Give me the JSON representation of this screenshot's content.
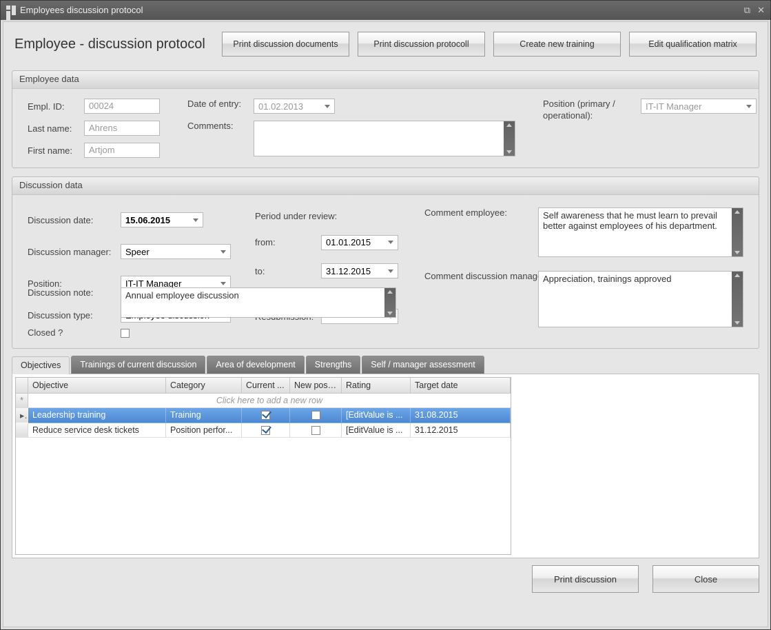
{
  "window_title": "Employees discussion protocol",
  "page_title": "Employee - discussion protocol",
  "toolbar": {
    "print_docs": "Print discussion documents",
    "print_protocol": "Print discussion protocoll",
    "create_training": "Create new training",
    "edit_matrix": "Edit qualification matrix"
  },
  "employee": {
    "group_title": "Employee data",
    "labels": {
      "empl_id": "Empl. ID:",
      "last_name": "Last name:",
      "first_name": "First name:",
      "date_of_entry": "Date of entry:",
      "comments": "Comments:",
      "position": "Position (primary / operational):"
    },
    "values": {
      "empl_id": "00024",
      "last_name": "Ahrens",
      "first_name": "Artjom",
      "date_of_entry": "01.02.2013",
      "comments": "",
      "position": "IT-IT Manager"
    }
  },
  "discussion": {
    "group_title": "Discussion data",
    "labels": {
      "date": "Discussion date:",
      "manager": "Discussion manager:",
      "position": "Position:",
      "type": "Discussion type:",
      "note": "Discussion note:",
      "closed": "Closed ?",
      "period": "Period under review:",
      "from": "from:",
      "to": "to:",
      "resubmission": "Resubmission:",
      "comment_employee": "Comment employee:",
      "comment_manager": "Comment discussion manager"
    },
    "values": {
      "date": "15.06.2015",
      "manager": "Speer",
      "position": "IT-IT Manager",
      "type": "Employee discussion",
      "note": "Annual employee discussion",
      "closed": false,
      "from": "01.01.2015",
      "to": "31.12.2015",
      "resubmission": "",
      "comment_employee": "Self awareness that he must learn to prevail better against employees of his department.",
      "comment_manager": "Appreciation, trainings approved"
    }
  },
  "tabs": [
    "Objectives",
    "Trainings of current discussion",
    "Area of development",
    "Strengths",
    "Self / manager assessment"
  ],
  "active_tab": 0,
  "grid": {
    "columns": [
      "Objective",
      "Category",
      "Current ...",
      "New positi...",
      "Rating",
      "Target date"
    ],
    "new_row_msg": "Click here to add a new row",
    "rows": [
      {
        "objective": "Leadership training",
        "category": "Training",
        "current": true,
        "newpos": false,
        "rating": "[EditValue is ...",
        "target": "31.08.2015",
        "selected": true
      },
      {
        "objective": "Reduce service desk tickets",
        "category": "Position perfor...",
        "current": true,
        "newpos": false,
        "rating": "[EditValue is ...",
        "target": "31.12.2015",
        "selected": false
      }
    ]
  },
  "footer": {
    "print": "Print discussion",
    "close": "Close"
  }
}
